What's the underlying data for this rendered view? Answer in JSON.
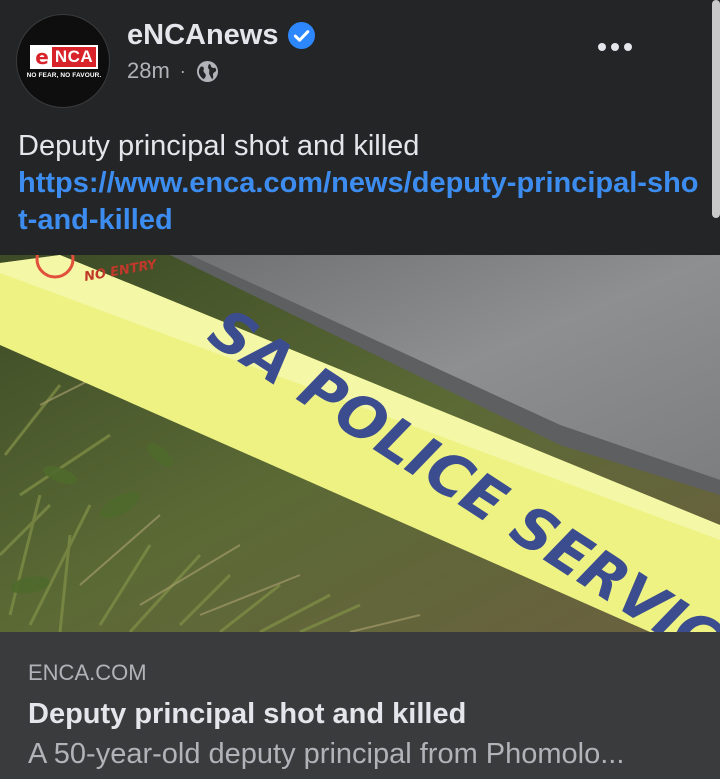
{
  "post": {
    "page_name": "eNCAnews",
    "time_ago": "28m",
    "separator": "·",
    "privacy_icon": "globe-icon",
    "verified_icon": "verified-badge-icon",
    "more_icon": "ellipsis-icon",
    "text": "Deputy principal shot and killed",
    "link": "https://www.enca.com/news/deputy-principal-shot-and-killed"
  },
  "avatar": {
    "logo_e": "e",
    "logo_nca": "NCA",
    "tagline": "NO FEAR, NO FAVOUR."
  },
  "image": {
    "tape_text": "SA POLICE SERVICE",
    "no_entry_text": "NO ENTRY"
  },
  "link_card": {
    "domain": "ENCA.COM",
    "title": "Deputy principal shot and killed",
    "description": "A 50-year-old deputy principal from Phomolo..."
  },
  "colors": {
    "background": "#242526",
    "card": "#3a3b3c",
    "link": "#3d8df0",
    "verified": "#2d88ff",
    "tape": "#f1f58a",
    "brand_red": "#d8232a"
  }
}
